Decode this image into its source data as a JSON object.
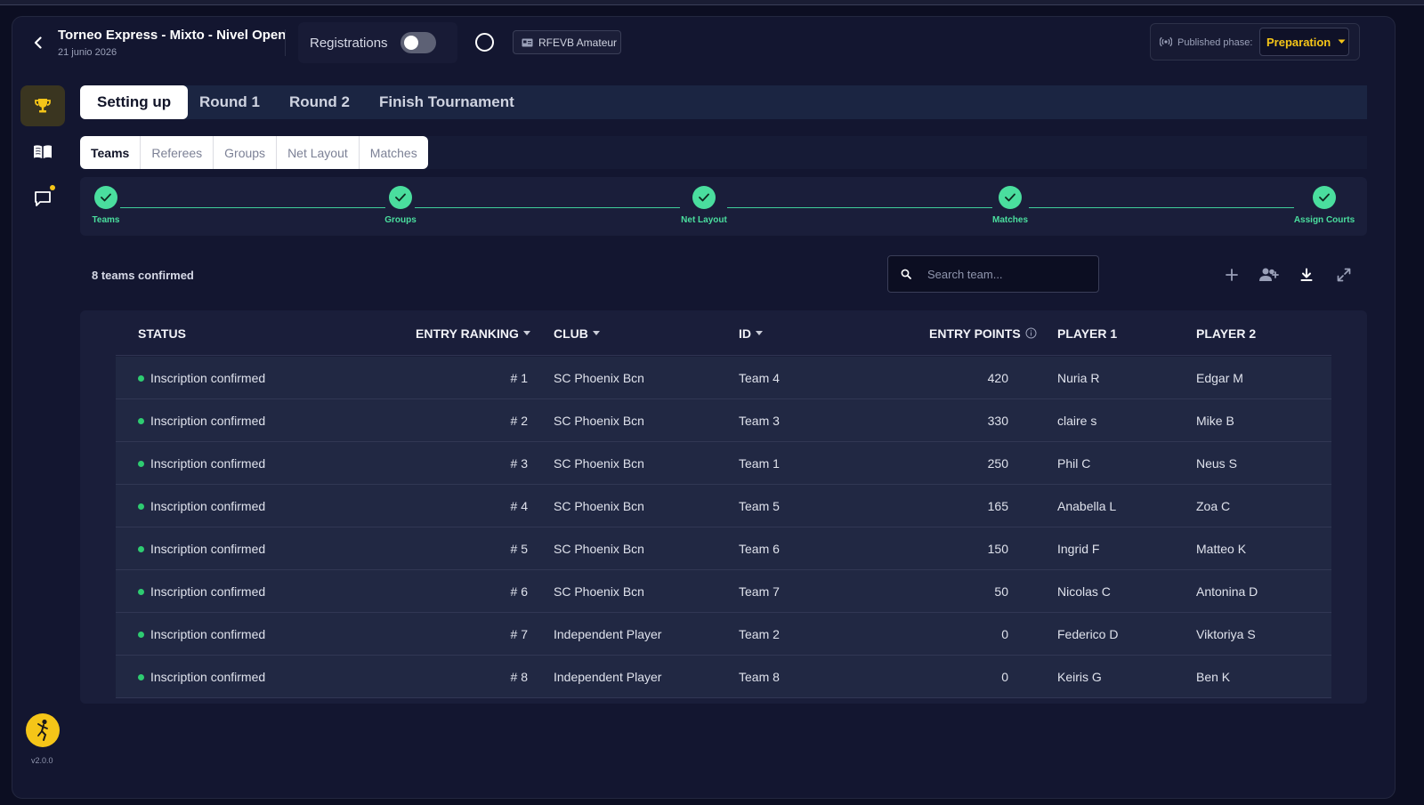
{
  "header": {
    "title": "Torneo Express - Mixto - Nivel Open",
    "date": "21 junio 2026",
    "registrations_label": "Registrations",
    "federation_badge": "RFEVB Amateur",
    "published_phase_label": "Published phase:",
    "published_phase_value": "Preparation"
  },
  "sidebar": {
    "version": "v2.0.0"
  },
  "phase_tabs": [
    {
      "label": "Setting up"
    },
    {
      "label": "Round 1"
    },
    {
      "label": "Round 2"
    },
    {
      "label": "Finish Tournament"
    }
  ],
  "sub_tabs": [
    {
      "label": "Teams"
    },
    {
      "label": "Referees"
    },
    {
      "label": "Groups"
    },
    {
      "label": "Net Layout"
    },
    {
      "label": "Matches"
    }
  ],
  "stepper": [
    {
      "label": "Teams"
    },
    {
      "label": "Groups"
    },
    {
      "label": "Net Layout"
    },
    {
      "label": "Matches"
    },
    {
      "label": "Assign Courts"
    }
  ],
  "toolbar": {
    "confirmed_text": "8 teams confirmed",
    "search_placeholder": "Search team..."
  },
  "table": {
    "columns": [
      "STATUS",
      "ENTRY RANKING",
      "CLUB",
      "ID",
      "ENTRY POINTS",
      "PLAYER 1",
      "PLAYER 2"
    ],
    "rows": [
      {
        "status": "Inscription confirmed",
        "ranking": "# 1",
        "club": "SC Phoenix Bcn",
        "id": "Team 4",
        "points": "420",
        "player1": "Nuria R",
        "player2": "Edgar M"
      },
      {
        "status": "Inscription confirmed",
        "ranking": "# 2",
        "club": "SC Phoenix Bcn",
        "id": "Team 3",
        "points": "330",
        "player1": "claire s",
        "player2": "Mike B"
      },
      {
        "status": "Inscription confirmed",
        "ranking": "# 3",
        "club": "SC Phoenix Bcn",
        "id": "Team 1",
        "points": "250",
        "player1": "Phil C",
        "player2": "Neus S"
      },
      {
        "status": "Inscription confirmed",
        "ranking": "# 4",
        "club": "SC Phoenix Bcn",
        "id": "Team 5",
        "points": "165",
        "player1": "Anabella  L",
        "player2": "Zoa C"
      },
      {
        "status": "Inscription confirmed",
        "ranking": "# 5",
        "club": "SC Phoenix Bcn",
        "id": "Team 6",
        "points": "150",
        "player1": "Ingrid F",
        "player2": "Matteo K"
      },
      {
        "status": "Inscription confirmed",
        "ranking": "# 6",
        "club": "SC Phoenix Bcn",
        "id": "Team 7",
        "points": "50",
        "player1": "Nicolas C",
        "player2": "Antonina D"
      },
      {
        "status": "Inscription confirmed",
        "ranking": "# 7",
        "club": "Independent Player",
        "id": "Team 2",
        "points": "0",
        "player1": "Federico D",
        "player2": "Viktoriya S"
      },
      {
        "status": "Inscription confirmed",
        "ranking": "# 8",
        "club": "Independent Player",
        "id": "Team 8",
        "points": "0",
        "player1": "Keiris G",
        "player2": "Ben K"
      }
    ]
  }
}
